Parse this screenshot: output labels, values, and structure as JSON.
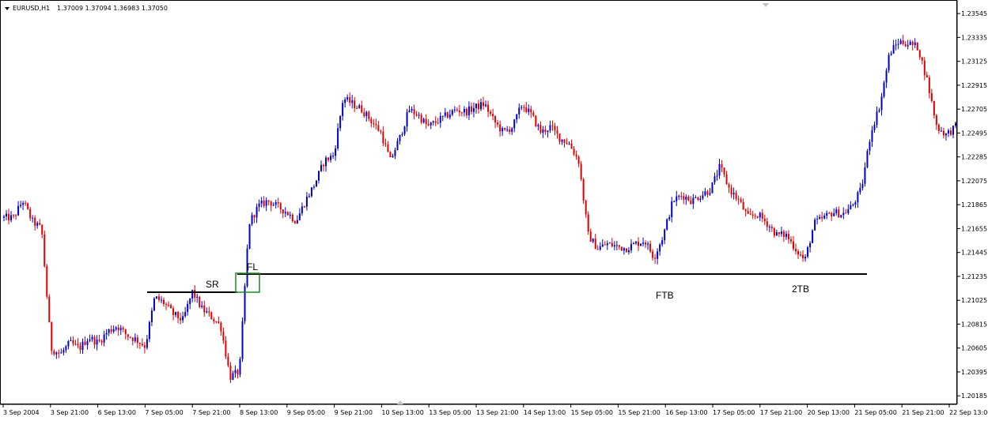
{
  "header": {
    "symbol": "EURUSD,H1",
    "ohlc": "1.37009 1.37094 1.36983 1.37050"
  },
  "chart_data": {
    "type": "candlestick",
    "colors": {
      "bull": "#0000cd",
      "bear": "#e00000",
      "level": "#000000",
      "box": "#008000"
    },
    "ylim": [
      1.2011,
      1.2365
    ],
    "y_ticks": [
      "1.23545",
      "1.23335",
      "1.23125",
      "1.22915",
      "1.22705",
      "1.22495",
      "1.22285",
      "1.22075",
      "1.21865",
      "1.21655",
      "1.21445",
      "1.21235",
      "1.21025",
      "1.20815",
      "1.20605",
      "1.20395",
      "1.20185"
    ],
    "x_ticks": [
      "3 Sep 2004",
      "3 Sep 21:00",
      "6 Sep 13:00",
      "7 Sep 05:00",
      "7 Sep 21:00",
      "8 Sep 13:00",
      "9 Sep 05:00",
      "9 Sep 21:00",
      "10 Sep 13:00",
      "13 Sep 05:00",
      "13 Sep 21:00",
      "14 Sep 13:00",
      "15 Sep 05:00",
      "15 Sep 21:00",
      "16 Sep 13:00",
      "17 Sep 05:00",
      "17 Sep 21:00",
      "20 Sep 13:00",
      "21 Sep 05:00",
      "21 Sep 21:00",
      "22 Sep 13:00"
    ],
    "price_path": [
      1.2175,
      1.2175,
      1.219,
      1.2172,
      1.2165,
      1.206,
      1.2055,
      1.2065,
      1.206,
      1.207,
      1.2065,
      1.2075,
      1.208,
      1.2072,
      1.2068,
      1.2062,
      1.2105,
      1.21,
      1.209,
      1.2085,
      1.211,
      1.2095,
      1.2088,
      1.208,
      1.2035,
      1.204,
      1.217,
      1.2185,
      1.219,
      1.2185,
      1.218,
      1.2172,
      1.219,
      1.2205,
      1.2225,
      1.223,
      1.228,
      1.2275,
      1.227,
      1.226,
      1.225,
      1.2225,
      1.2245,
      1.227,
      1.2265,
      1.2255,
      1.226,
      1.2265,
      1.227,
      1.2268,
      1.2272,
      1.2275,
      1.226,
      1.225,
      1.2255,
      1.2275,
      1.2265,
      1.225,
      1.2255,
      1.2245,
      1.224,
      1.2225,
      1.216,
      1.2148,
      1.2152,
      1.215,
      1.2148,
      1.2152,
      1.2155,
      1.214,
      1.216,
      1.219,
      1.2195,
      1.219,
      1.2195,
      1.22,
      1.222,
      1.22,
      1.219,
      1.2175,
      1.2178,
      1.217,
      1.216,
      1.216,
      1.2148,
      1.2137,
      1.217,
      1.2175,
      1.218,
      1.2178,
      1.2185,
      1.22,
      1.225,
      1.2275,
      1.232,
      1.233,
      1.2328,
      1.2325,
      1.2295,
      1.2255,
      1.2248,
      1.2255
    ],
    "levels": [
      {
        "label": "SR",
        "price": 1.2121
      },
      {
        "label": "FL",
        "price": 1.2133
      }
    ],
    "annotations": [
      "SR",
      "FL",
      "FTB",
      "2TB"
    ],
    "grid": false,
    "legend": "none"
  }
}
